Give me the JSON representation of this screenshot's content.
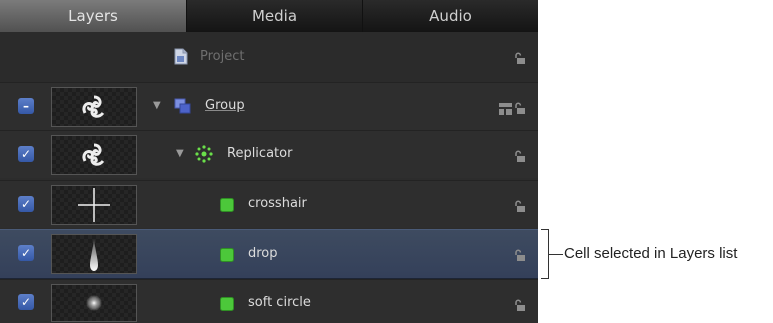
{
  "tabs": [
    {
      "label": "Layers",
      "active": true
    },
    {
      "label": "Media",
      "active": false
    },
    {
      "label": "Audio",
      "active": false
    }
  ],
  "rows": [
    {
      "name": "Project",
      "type": "project",
      "icon": "project-document-icon"
    },
    {
      "name": "Group",
      "type": "group",
      "checkbox": "mixed",
      "expanded": true,
      "icon": "group-icon",
      "thumbnail": "replicator-swirl"
    },
    {
      "name": "Replicator",
      "type": "replicator",
      "checkbox": "checked",
      "expanded": true,
      "icon": "replicator-icon",
      "thumbnail": "replicator-swirl"
    },
    {
      "name": "crosshair",
      "type": "cell",
      "checkbox": "checked",
      "icon": "cell-icon",
      "thumbnail": "crosshair"
    },
    {
      "name": "drop",
      "type": "cell",
      "checkbox": "checked",
      "icon": "cell-icon",
      "thumbnail": "drop",
      "selected": true
    },
    {
      "name": "soft circle",
      "type": "cell",
      "checkbox": "checked",
      "icon": "cell-icon",
      "thumbnail": "soft-circle"
    }
  ],
  "callout": {
    "text": "Cell selected in Layers list"
  },
  "colors": {
    "selection": "#3a4760",
    "checkbox": "#4a6cb8",
    "cell_icon": "#4cc83a",
    "replicator_icon": "#6adf4a"
  }
}
